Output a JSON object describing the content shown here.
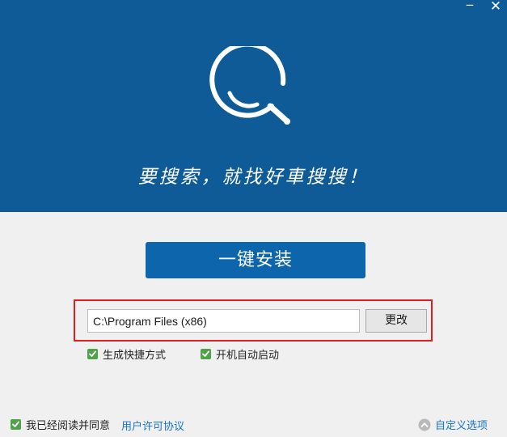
{
  "window": {
    "minimize_glyph": "‒",
    "close_glyph": "✕"
  },
  "header": {
    "logo_icon": "magnifier-logo-icon",
    "slogan": "要搜索，就找好車搜搜！"
  },
  "main": {
    "install_button_label": "一键安装",
    "install_path": "C:\\Program Files (x86)",
    "change_button_label": "更改",
    "options": {
      "create_shortcut": {
        "label": "生成快捷方式",
        "checked": true
      },
      "auto_start": {
        "label": "开机自动启动",
        "checked": true
      }
    }
  },
  "footer": {
    "agree_label": "我已经阅读并同意",
    "agree_checked": true,
    "license_link": "用户许可协议",
    "custom_options_label": "自定义选项",
    "custom_options_icon": "chevron-up-circle-icon"
  },
  "colors": {
    "header_bg": "#0e5b97",
    "install_button_bg": "#0d66ac",
    "checkbox_green": "#4fa24a",
    "link_blue": "#1a74c6",
    "highlight_red": "#e02020"
  }
}
